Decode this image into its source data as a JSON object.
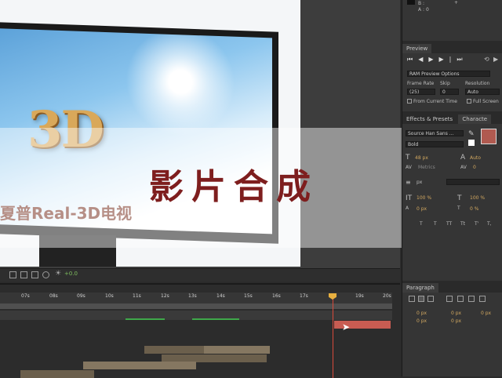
{
  "viewer": {
    "logo_text": "3D",
    "brand_text": "夏普Real-3D电视",
    "title_text": "影片合成",
    "exposure_value": "+0.0"
  },
  "info_panel": {
    "b_label": "B :",
    "a_label": "A : 0"
  },
  "preview_panel": {
    "tab": "Preview",
    "ram_options": "RAM Preview Options",
    "frame_rate_label": "Frame Rate",
    "skip_label": "Skip",
    "resolution_label": "Resolution",
    "frame_rate_value": "(25)",
    "skip_value": "0",
    "resolution_value": "Auto",
    "from_current_time": "From Current Time",
    "full_screen": "Full Screen"
  },
  "character_panel": {
    "tab_effects": "Effects & Presets",
    "tab_character": "Characte",
    "font_family": "Source Han Sans ...",
    "font_style": "Bold",
    "font_size": "48 px",
    "leading": "Auto",
    "kerning": "Metrics",
    "tracking": "0",
    "stroke_width": "px",
    "vscale": "100 %",
    "hscale": "100 %",
    "baseline": "0 px",
    "tsume": "0 %",
    "style_buttons": [
      "T",
      "T",
      "TT",
      "Tt",
      "T'",
      "T,"
    ]
  },
  "paragraph_panel": {
    "tab": "Paragraph",
    "indent_left": "0 px",
    "indent_right": "0 px",
    "first_line": "0 px",
    "space_before": "0 px",
    "space_after": "0 px"
  },
  "timeline": {
    "ticks": [
      "07s",
      "08s",
      "09s",
      "10s",
      "11s",
      "12s",
      "13s",
      "14s",
      "15s",
      "16s",
      "17s",
      "",
      "19s",
      "20s"
    ]
  },
  "colors": {
    "title": "#7e1e1e",
    "selected_layer": "#c85c52",
    "playhead": "#d84a3a",
    "brand_text": "#7a3424"
  }
}
